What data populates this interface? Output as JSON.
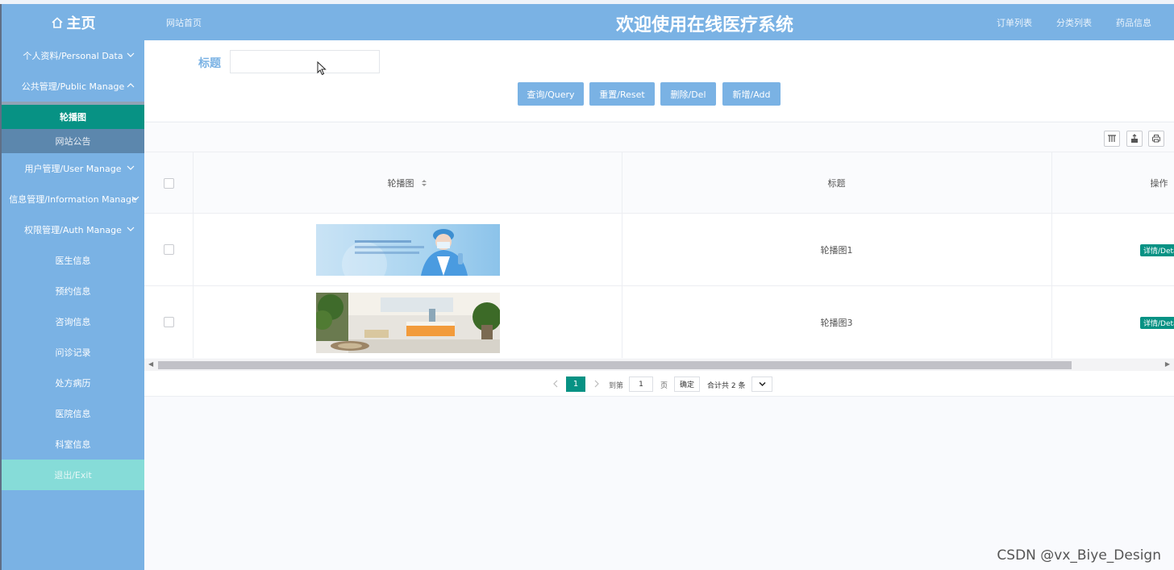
{
  "header": {
    "brand": "主页",
    "nav_home": "网站首页",
    "title": "欢迎使用在线医疗系统",
    "links": [
      "订单列表",
      "分类列表",
      "药品信息"
    ]
  },
  "sidebar": {
    "items": [
      {
        "label": "个人资料/Personal Data"
      },
      {
        "label": "公共管理/Public Manage"
      },
      {
        "label": "用户管理/User Manage"
      },
      {
        "label": "信息管理/Information Manage"
      },
      {
        "label": "权限管理/Auth Manage"
      }
    ],
    "subs": [
      {
        "label": "轮播图"
      },
      {
        "label": "网站公告"
      }
    ],
    "plain": [
      "医生信息",
      "预约信息",
      "咨询信息",
      "问诊记录",
      "处方病历",
      "医院信息",
      "科室信息"
    ],
    "exit": "退出/Exit"
  },
  "search": {
    "label": "标题",
    "value": "",
    "buttons": {
      "query": "查询/Query",
      "reset": "重置/Reset",
      "delete": "删除/Del",
      "add": "新增/Add"
    }
  },
  "table": {
    "columns": {
      "image": "轮播图",
      "title": "标题",
      "action": "操作"
    },
    "rows": [
      {
        "title": "轮播图1",
        "action": "详情/Details"
      },
      {
        "title": "轮播图3",
        "action": "详情/Details"
      }
    ]
  },
  "pager": {
    "current": "1",
    "goto_prefix": "到第",
    "goto_value": "1",
    "goto_suffix": "页",
    "confirm": "确定",
    "total": "合计共 2 条"
  },
  "watermark": "CSDN @vx_Biye_Design",
  "colors": {
    "header_bg": "#7ab2e4",
    "active_teal": "#079284",
    "exit_bg": "#86dcd8"
  }
}
